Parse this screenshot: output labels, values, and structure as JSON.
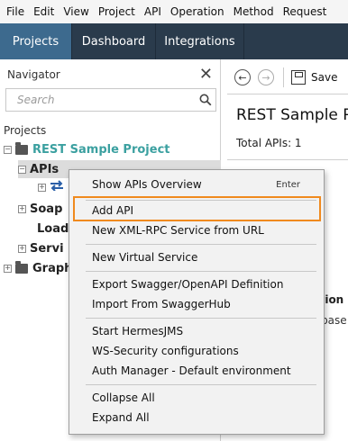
{
  "menubar": [
    "File",
    "Edit",
    "View",
    "Project",
    "API",
    "Operation",
    "Method",
    "Request"
  ],
  "tabs": [
    {
      "label": "Projects",
      "active": true
    },
    {
      "label": "Dashboard",
      "active": false
    },
    {
      "label": "Integrations",
      "active": false
    }
  ],
  "navigator": {
    "title": "Navigator",
    "search_placeholder": "Search",
    "projects_label": "Projects",
    "tree": {
      "project": "REST Sample Project",
      "apis": "APIs",
      "soap": "Soap",
      "load": "LoadU",
      "serv": "Servi",
      "graph": "Graph"
    }
  },
  "toolbar": {
    "save_label": "Save"
  },
  "content": {
    "title": "REST Sample P",
    "total_apis": "Total APIs: 1",
    "fragment_heading": "ption",
    "fragment_text": "s base"
  },
  "context_menu": {
    "items": [
      {
        "label": "Show APIs Overview",
        "shortcut": "Enter"
      },
      {
        "label": "Add API",
        "shortcut": ""
      },
      {
        "label": "New XML-RPC Service from URL",
        "shortcut": ""
      },
      {
        "label": "New Virtual Service",
        "shortcut": ""
      },
      {
        "label": "Export Swagger/OpenAPI Definition",
        "shortcut": ""
      },
      {
        "label": "Import From SwaggerHub",
        "shortcut": ""
      },
      {
        "label": "Start HermesJMS",
        "shortcut": ""
      },
      {
        "label": "WS-Security configurations",
        "shortcut": ""
      },
      {
        "label": "Auth Manager - Default environment",
        "shortcut": ""
      },
      {
        "label": "Collapse All",
        "shortcut": ""
      },
      {
        "label": "Expand All",
        "shortcut": ""
      }
    ]
  },
  "colors": {
    "tab_bar": "#2a3b4c",
    "active_tab": "#3d6a8e",
    "project_name": "#3ba0a0",
    "highlight_box": "#f08a1e"
  }
}
